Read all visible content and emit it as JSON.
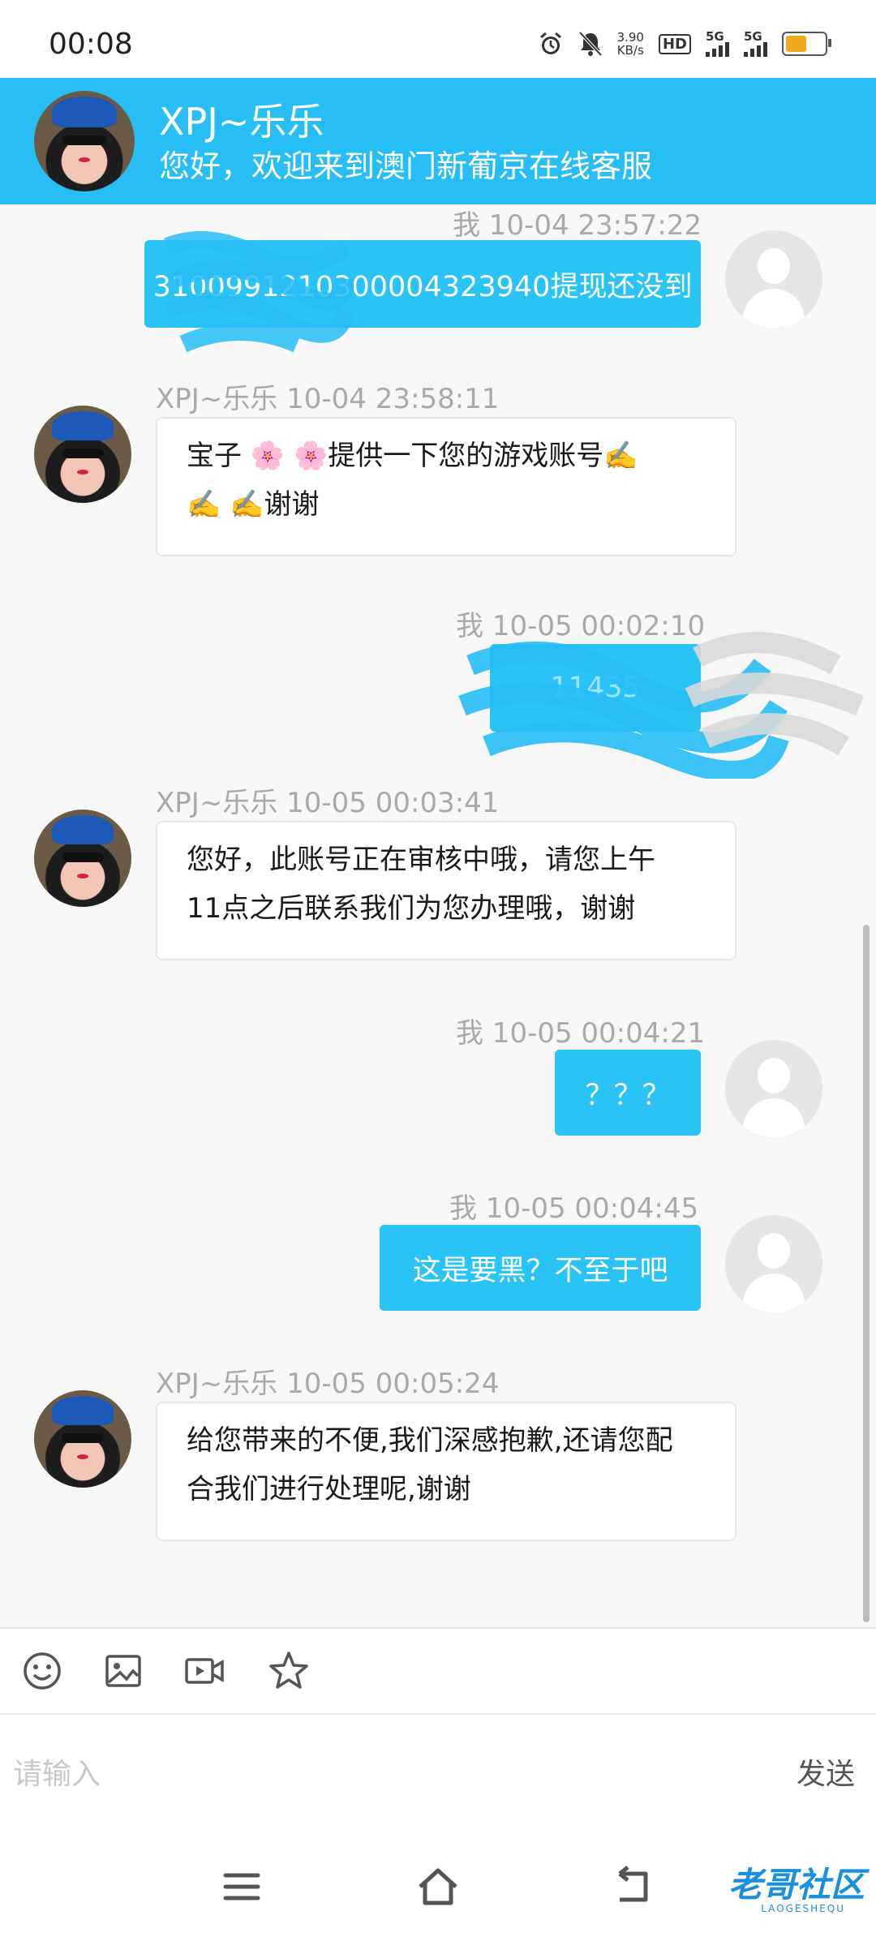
{
  "status_bar": {
    "time": "00:08",
    "net_speed_value": "3.90",
    "net_speed_unit": "KB/s",
    "hd_label": "HD",
    "sim1_label": "5G",
    "sim2_label": "5G",
    "battery_percent": 55
  },
  "header": {
    "title": "XPJ~乐乐",
    "subtitle": "您好，欢迎来到澳门新葡京在线客服"
  },
  "messages": {
    "m1": {
      "meta": "我  10-04 23:57:22",
      "text": "3100991210300004323940提现还没到"
    },
    "m2": {
      "meta": "XPJ~乐乐  10-04 23:58:11",
      "line1": "宝子 🌸 🌸提供一下您的游戏账号✍️",
      "line2": "✍️  ✍️谢谢"
    },
    "m3": {
      "meta": "我  10-05 00:02:10",
      "text": "11435"
    },
    "m4": {
      "meta": "XPJ~乐乐  10-05 00:03:41",
      "line1": "您好，此账号正在审核中哦，请您上午",
      "line2": "11点之后联系我们为您办理哦，谢谢"
    },
    "m5": {
      "meta": "我  10-05 00:04:21",
      "text": "？？？"
    },
    "m6": {
      "meta": "我  10-05 00:04:45",
      "text": "这是要黑？不至于吧"
    },
    "m7": {
      "meta": "XPJ~乐乐  10-05 00:05:24",
      "line1": "给您带来的不便,我们深感抱歉,还请您配",
      "line2": "合我们进行处理呢,谢谢"
    }
  },
  "toolbar": {
    "icons": [
      "emoji-icon",
      "image-icon",
      "video-icon",
      "star-icon"
    ]
  },
  "input": {
    "placeholder": "请输入",
    "send_label": "发送"
  },
  "navbar": {
    "watermark": "老哥社区",
    "watermark_sub": "LAOGESHEQU"
  },
  "colors": {
    "accent": "#27bdf5",
    "bubble_me": "#29c3f6",
    "battery": "#f0a91c"
  }
}
